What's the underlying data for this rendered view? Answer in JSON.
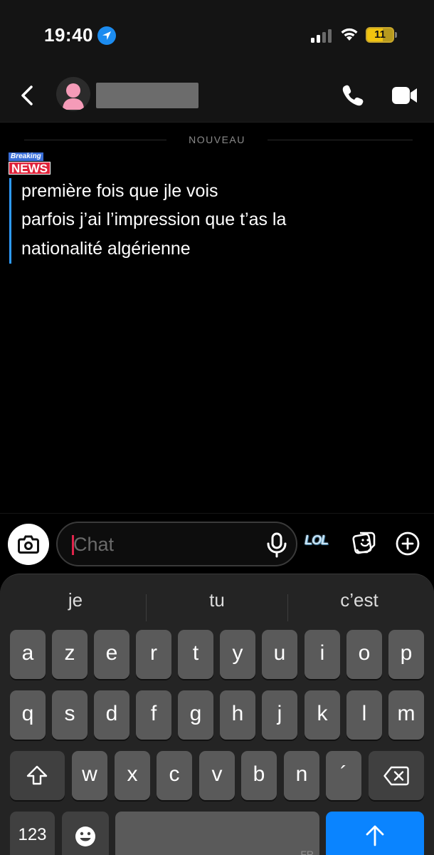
{
  "status_bar": {
    "time": "19:40",
    "battery": "11",
    "location_icon": "location-arrow-icon",
    "signal_icon": "cell-signal-icon",
    "wifi_icon": "wifi-icon",
    "battery_fill": 0.11
  },
  "header": {
    "back_icon": "chevron-left-icon",
    "avatar_icon": "default-avatar-icon",
    "call_icon": "phone-icon",
    "video_icon": "video-camera-icon"
  },
  "chat": {
    "new_divider": "NOUVEAU",
    "sticker": {
      "top": "Breaking",
      "bottom": "NEWS"
    },
    "message_lines": [
      "première fois que jle vois",
      "parfois j’ai l’impression que t’as la",
      "nationalité algérienne"
    ]
  },
  "composer": {
    "placeholder": "Chat",
    "camera_icon": "camera-icon",
    "mic_icon": "microphone-icon",
    "lol_label": "LOL",
    "sticker_icon": "sticker-icon",
    "plus_icon": "plus-circle-icon"
  },
  "keyboard": {
    "suggestions": [
      "je",
      "tu",
      "c’est"
    ],
    "row1": [
      "a",
      "z",
      "e",
      "r",
      "t",
      "y",
      "u",
      "i",
      "o",
      "p"
    ],
    "row2": [
      "q",
      "s",
      "d",
      "f",
      "g",
      "h",
      "j",
      "k",
      "l",
      "m"
    ],
    "row3": [
      "w",
      "x",
      "c",
      "v",
      "b",
      "n",
      "´"
    ],
    "numbers_label": "123",
    "space_lang": "FR",
    "colors": {
      "accent": "#0a84ff",
      "key": "#5a5a5a",
      "key_dark": "#404040",
      "background": "#242424"
    }
  }
}
